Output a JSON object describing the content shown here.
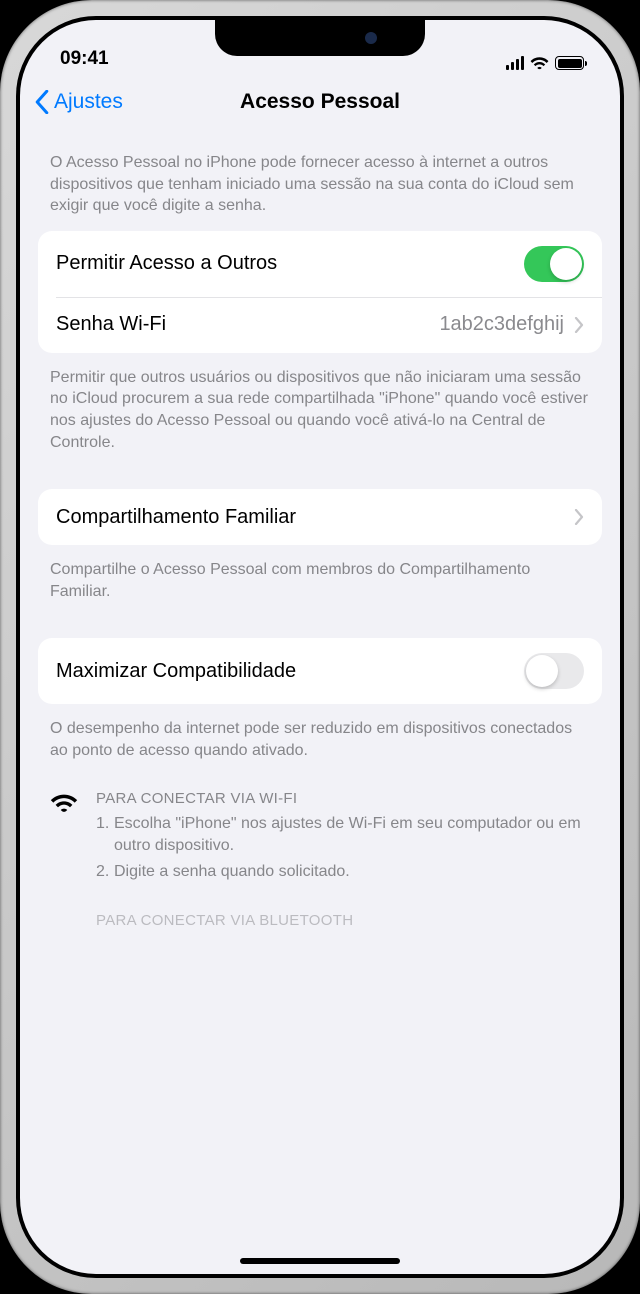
{
  "status": {
    "time": "09:41"
  },
  "nav": {
    "back": "Ajustes",
    "title": "Acesso Pessoal"
  },
  "intro": "O Acesso Pessoal no iPhone pode fornecer acesso à internet a outros dispositivos que tenham iniciado uma sessão na sua conta do iCloud sem exigir que você digite a senha.",
  "rows": {
    "allow_others": "Permitir Acesso a Outros",
    "wifi_password_label": "Senha Wi-Fi",
    "wifi_password_value": "1ab2c3defghij",
    "family_sharing": "Compartilhamento Familiar",
    "maximize_compat": "Maximizar Compatibilidade"
  },
  "footers": {
    "allow_others": "Permitir que outros usuários ou dispositivos que não iniciaram uma sessão no iCloud procurem a sua rede compartilhada \"iPhone\" quando você estiver nos ajustes do Acesso Pessoal ou quando você ativá-lo na Central de Controle.",
    "family_sharing": "Compartilhe o Acesso Pessoal com membros do Compartilhamento Familiar.",
    "maximize_compat": "O desempenho da internet pode ser reduzido em dispositivos conectados ao ponto de acesso quando ativado."
  },
  "instructions": {
    "wifi_title": "PARA CONECTAR VIA WI-FI",
    "wifi_step1": "Escolha \"iPhone\" nos ajustes de Wi-Fi em seu computador ou em outro dispositivo.",
    "wifi_step2": "Digite a senha quando solicitado.",
    "bt_title": "PARA CONECTAR VIA BLUETOOTH"
  }
}
